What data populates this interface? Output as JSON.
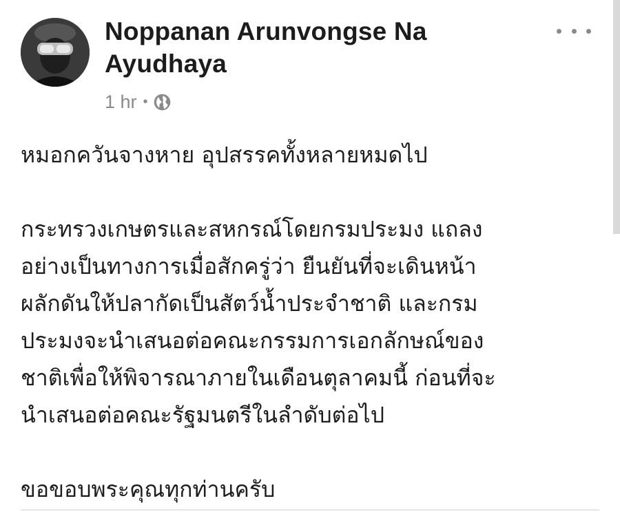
{
  "post": {
    "author": "Noppanan Arunvongse Na Ayudhaya",
    "time": "1 hr",
    "separator": "•",
    "privacy_icon": "globe-icon",
    "more_icon": "more-options-icon",
    "paragraphs": [
      "หมอกควันจางหาย อุปสรรคทั้งหลายหมดไป",
      "กระทรวงเกษตรและสหกรณ์โดยกรมประมง แถลง\nอย่างเป็นทางการเมื่อสักครู่ว่า ยืนยันที่จะเดินหน้า\nผลักดันให้ปลากัดเป็นสัตว์น้ำประจำชาติ และกรม\nประมงจะนำเสนอต่อคณะกรรมการเอกลักษณ์ของ\nชาติเพื่อให้พิจารณาภายในเดือนตุลาคมนี้ ก่อนที่จะ\nนำเสนอต่อคณะรัฐมนตรีในลำดับต่อไป",
      "ขอขอบพระคุณทุกท่านครับ"
    ]
  },
  "colors": {
    "text": "#1d1d1d",
    "meta": "#8a8a8a",
    "background": "#ffffff"
  }
}
